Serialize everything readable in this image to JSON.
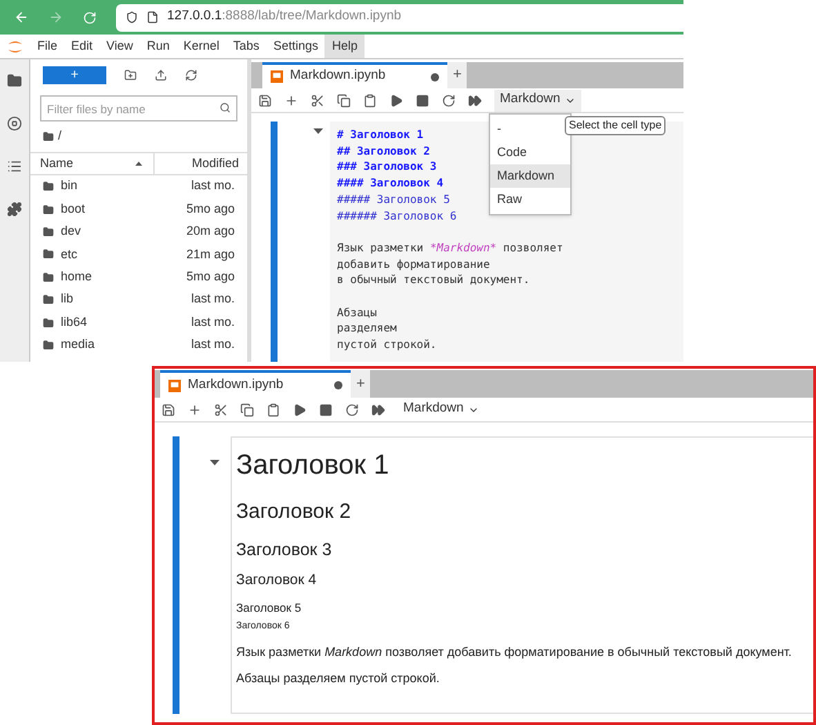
{
  "browser": {
    "back_disabled": false,
    "forward_disabled": true,
    "address": {
      "host": "127.0.0.1",
      "rest": ":8888/lab/tree/Markdown.ipynb"
    }
  },
  "menu": [
    {
      "label": "File",
      "selected": false
    },
    {
      "label": "Edit",
      "selected": false
    },
    {
      "label": "View",
      "selected": false
    },
    {
      "label": "Run",
      "selected": false
    },
    {
      "label": "Kernel",
      "selected": false
    },
    {
      "label": "Tabs",
      "selected": false
    },
    {
      "label": "Settings",
      "selected": false
    },
    {
      "label": "Help",
      "selected": true
    }
  ],
  "file_browser": {
    "new_button": "+",
    "filter_placeholder": "Filter files by name",
    "path": "/",
    "columns": [
      "Name",
      "Modified"
    ],
    "rows": [
      {
        "name": "bin",
        "modified": "last mo."
      },
      {
        "name": "boot",
        "modified": "5mo ago"
      },
      {
        "name": "dev",
        "modified": "20m ago"
      },
      {
        "name": "etc",
        "modified": "21m ago"
      },
      {
        "name": "home",
        "modified": "5mo ago"
      },
      {
        "name": "lib",
        "modified": "last mo."
      },
      {
        "name": "lib64",
        "modified": "last mo."
      },
      {
        "name": "media",
        "modified": "last mo."
      }
    ]
  },
  "notebook": {
    "tab": {
      "title": "Markdown.ipynb",
      "unsaved": true,
      "add": "+"
    },
    "cell_type": "Markdown",
    "cell_type_menu": {
      "items": [
        {
          "label": "-",
          "selected": false
        },
        {
          "label": "Code",
          "selected": false
        },
        {
          "label": "Markdown",
          "selected": true
        },
        {
          "label": "Raw",
          "selected": false
        }
      ],
      "tooltip": "Select the cell type"
    },
    "source": {
      "headings": [
        {
          "text": "# Заголовок 1",
          "bold": true
        },
        {
          "text": "## Заголовок 2",
          "bold": true
        },
        {
          "text": "### Заголовок 3",
          "bold": true
        },
        {
          "text": "#### Заголовок 4",
          "bold": true
        },
        {
          "text": "##### Заголовок 5",
          "bold": false
        },
        {
          "text": "###### Заголовок 6",
          "bold": false
        }
      ],
      "paragraphs": [
        [
          [
            {
              "text": "Язык разметки ",
              "kind": "plain"
            },
            {
              "text": "*Markdown*",
              "kind": "emphasis"
            },
            {
              "text": " позволяет",
              "kind": "plain"
            }
          ],
          [
            {
              "text": "добавить форматирование",
              "kind": "plain"
            }
          ],
          [
            {
              "text": "в обычный текстовый документ.",
              "kind": "plain"
            }
          ]
        ],
        [
          [
            {
              "text": "Абзацы",
              "kind": "plain"
            }
          ],
          [
            {
              "text": "разделяем",
              "kind": "plain"
            }
          ],
          [
            {
              "text": "пустой строкой.",
              "kind": "plain"
            }
          ]
        ]
      ]
    }
  },
  "inset": {
    "tab": {
      "title": "Markdown.ipynb",
      "unsaved": true,
      "add": "+"
    },
    "cell_type": "Markdown",
    "rendered": {
      "headings": [
        "Заголовок 1",
        "Заголовок 2",
        "Заголовок 3",
        "Заголовок 4",
        "Заголовок 5",
        "Заголовок 6"
      ],
      "paragraphs": [
        "Язык разметки *Markdown* позволяет добавить форматирование в обычный текстовый документ.",
        "Абзацы разделяем пустой строкой."
      ]
    }
  }
}
